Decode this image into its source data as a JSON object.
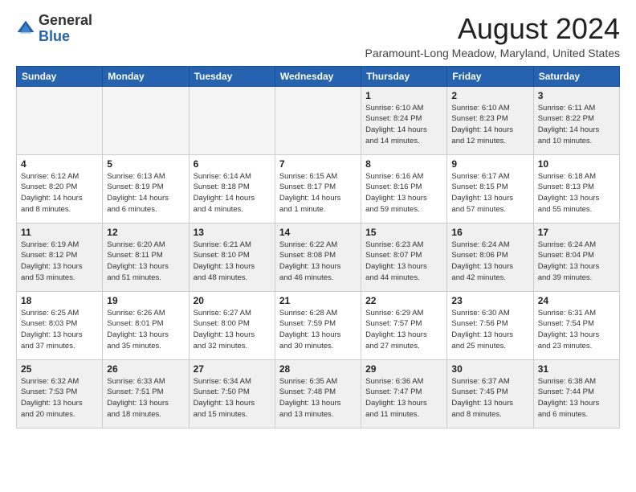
{
  "logo": {
    "general": "General",
    "blue": "Blue"
  },
  "title": "August 2024",
  "subtitle": "Paramount-Long Meadow, Maryland, United States",
  "days_of_week": [
    "Sunday",
    "Monday",
    "Tuesday",
    "Wednesday",
    "Thursday",
    "Friday",
    "Saturday"
  ],
  "weeks": [
    [
      {
        "day": "",
        "info": ""
      },
      {
        "day": "",
        "info": ""
      },
      {
        "day": "",
        "info": ""
      },
      {
        "day": "",
        "info": ""
      },
      {
        "day": "1",
        "info": "Sunrise: 6:10 AM\nSunset: 8:24 PM\nDaylight: 14 hours\nand 14 minutes."
      },
      {
        "day": "2",
        "info": "Sunrise: 6:10 AM\nSunset: 8:23 PM\nDaylight: 14 hours\nand 12 minutes."
      },
      {
        "day": "3",
        "info": "Sunrise: 6:11 AM\nSunset: 8:22 PM\nDaylight: 14 hours\nand 10 minutes."
      }
    ],
    [
      {
        "day": "4",
        "info": "Sunrise: 6:12 AM\nSunset: 8:20 PM\nDaylight: 14 hours\nand 8 minutes."
      },
      {
        "day": "5",
        "info": "Sunrise: 6:13 AM\nSunset: 8:19 PM\nDaylight: 14 hours\nand 6 minutes."
      },
      {
        "day": "6",
        "info": "Sunrise: 6:14 AM\nSunset: 8:18 PM\nDaylight: 14 hours\nand 4 minutes."
      },
      {
        "day": "7",
        "info": "Sunrise: 6:15 AM\nSunset: 8:17 PM\nDaylight: 14 hours\nand 1 minute."
      },
      {
        "day": "8",
        "info": "Sunrise: 6:16 AM\nSunset: 8:16 PM\nDaylight: 13 hours\nand 59 minutes."
      },
      {
        "day": "9",
        "info": "Sunrise: 6:17 AM\nSunset: 8:15 PM\nDaylight: 13 hours\nand 57 minutes."
      },
      {
        "day": "10",
        "info": "Sunrise: 6:18 AM\nSunset: 8:13 PM\nDaylight: 13 hours\nand 55 minutes."
      }
    ],
    [
      {
        "day": "11",
        "info": "Sunrise: 6:19 AM\nSunset: 8:12 PM\nDaylight: 13 hours\nand 53 minutes."
      },
      {
        "day": "12",
        "info": "Sunrise: 6:20 AM\nSunset: 8:11 PM\nDaylight: 13 hours\nand 51 minutes."
      },
      {
        "day": "13",
        "info": "Sunrise: 6:21 AM\nSunset: 8:10 PM\nDaylight: 13 hours\nand 48 minutes."
      },
      {
        "day": "14",
        "info": "Sunrise: 6:22 AM\nSunset: 8:08 PM\nDaylight: 13 hours\nand 46 minutes."
      },
      {
        "day": "15",
        "info": "Sunrise: 6:23 AM\nSunset: 8:07 PM\nDaylight: 13 hours\nand 44 minutes."
      },
      {
        "day": "16",
        "info": "Sunrise: 6:24 AM\nSunset: 8:06 PM\nDaylight: 13 hours\nand 42 minutes."
      },
      {
        "day": "17",
        "info": "Sunrise: 6:24 AM\nSunset: 8:04 PM\nDaylight: 13 hours\nand 39 minutes."
      }
    ],
    [
      {
        "day": "18",
        "info": "Sunrise: 6:25 AM\nSunset: 8:03 PM\nDaylight: 13 hours\nand 37 minutes."
      },
      {
        "day": "19",
        "info": "Sunrise: 6:26 AM\nSunset: 8:01 PM\nDaylight: 13 hours\nand 35 minutes."
      },
      {
        "day": "20",
        "info": "Sunrise: 6:27 AM\nSunset: 8:00 PM\nDaylight: 13 hours\nand 32 minutes."
      },
      {
        "day": "21",
        "info": "Sunrise: 6:28 AM\nSunset: 7:59 PM\nDaylight: 13 hours\nand 30 minutes."
      },
      {
        "day": "22",
        "info": "Sunrise: 6:29 AM\nSunset: 7:57 PM\nDaylight: 13 hours\nand 27 minutes."
      },
      {
        "day": "23",
        "info": "Sunrise: 6:30 AM\nSunset: 7:56 PM\nDaylight: 13 hours\nand 25 minutes."
      },
      {
        "day": "24",
        "info": "Sunrise: 6:31 AM\nSunset: 7:54 PM\nDaylight: 13 hours\nand 23 minutes."
      }
    ],
    [
      {
        "day": "25",
        "info": "Sunrise: 6:32 AM\nSunset: 7:53 PM\nDaylight: 13 hours\nand 20 minutes."
      },
      {
        "day": "26",
        "info": "Sunrise: 6:33 AM\nSunset: 7:51 PM\nDaylight: 13 hours\nand 18 minutes."
      },
      {
        "day": "27",
        "info": "Sunrise: 6:34 AM\nSunset: 7:50 PM\nDaylight: 13 hours\nand 15 minutes."
      },
      {
        "day": "28",
        "info": "Sunrise: 6:35 AM\nSunset: 7:48 PM\nDaylight: 13 hours\nand 13 minutes."
      },
      {
        "day": "29",
        "info": "Sunrise: 6:36 AM\nSunset: 7:47 PM\nDaylight: 13 hours\nand 11 minutes."
      },
      {
        "day": "30",
        "info": "Sunrise: 6:37 AM\nSunset: 7:45 PM\nDaylight: 13 hours\nand 8 minutes."
      },
      {
        "day": "31",
        "info": "Sunrise: 6:38 AM\nSunset: 7:44 PM\nDaylight: 13 hours\nand 6 minutes."
      }
    ]
  ]
}
